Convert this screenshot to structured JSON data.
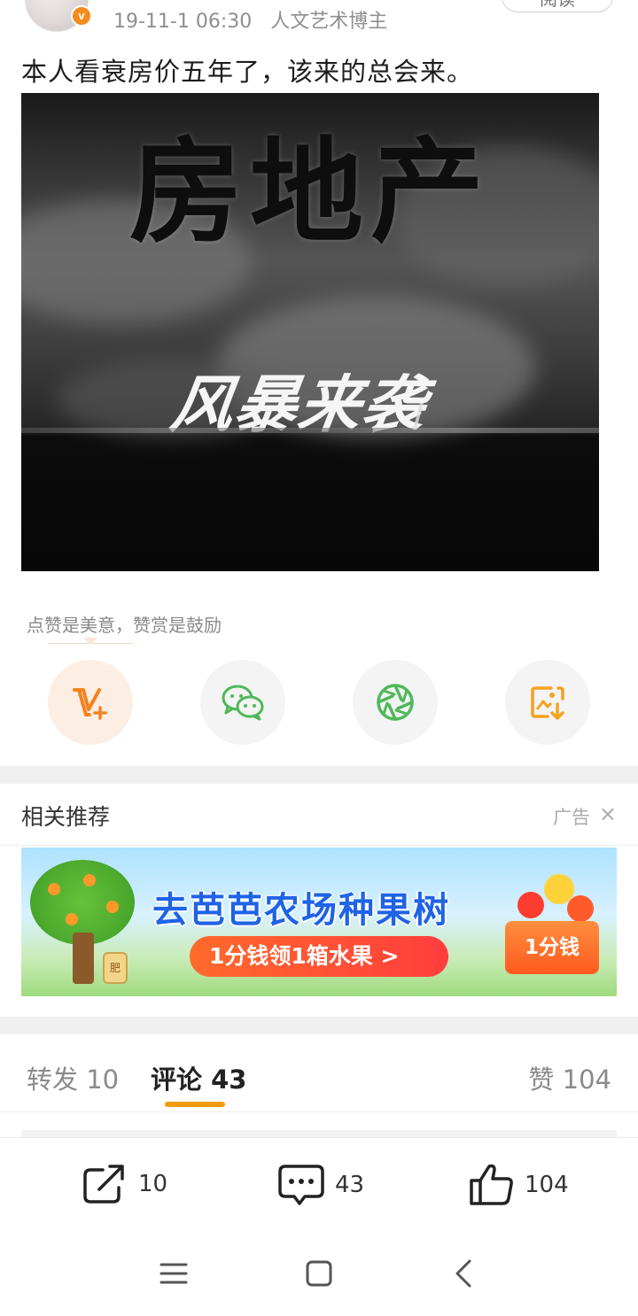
{
  "post": {
    "time": "19-11-1 06:30",
    "author_tag": "人文艺术博主",
    "read_label": "阅读",
    "text": "本人看衰房价五年了，该来的总会来。",
    "verified_badge": "v",
    "image": {
      "title": "房地产",
      "subtitle": "风暴来袭"
    }
  },
  "reward": {
    "tip": "点赞是美意，赞赏是鼓励"
  },
  "share_buttons": [
    {
      "icon": "reward-v-plus-icon"
    },
    {
      "icon": "wechat-icon"
    },
    {
      "icon": "moments-icon"
    },
    {
      "icon": "save-image-icon"
    }
  ],
  "related": {
    "title": "相关推荐",
    "ad_label": "广告",
    "close": "×"
  },
  "ad": {
    "headline": "去芭芭农场种果树",
    "pill": "1分钱领1箱水果 >",
    "badge": "1分钱",
    "jar_label": "肥"
  },
  "tabs": {
    "repost": "转发 10",
    "comment": "评论 43",
    "like": "赞 104"
  },
  "actions": {
    "repost_count": "10",
    "comment_count": "43",
    "like_count": "104"
  },
  "colors": {
    "accent": "#f29a10",
    "verified": "#f58a1f",
    "wechat_green": "#4fb85a"
  }
}
